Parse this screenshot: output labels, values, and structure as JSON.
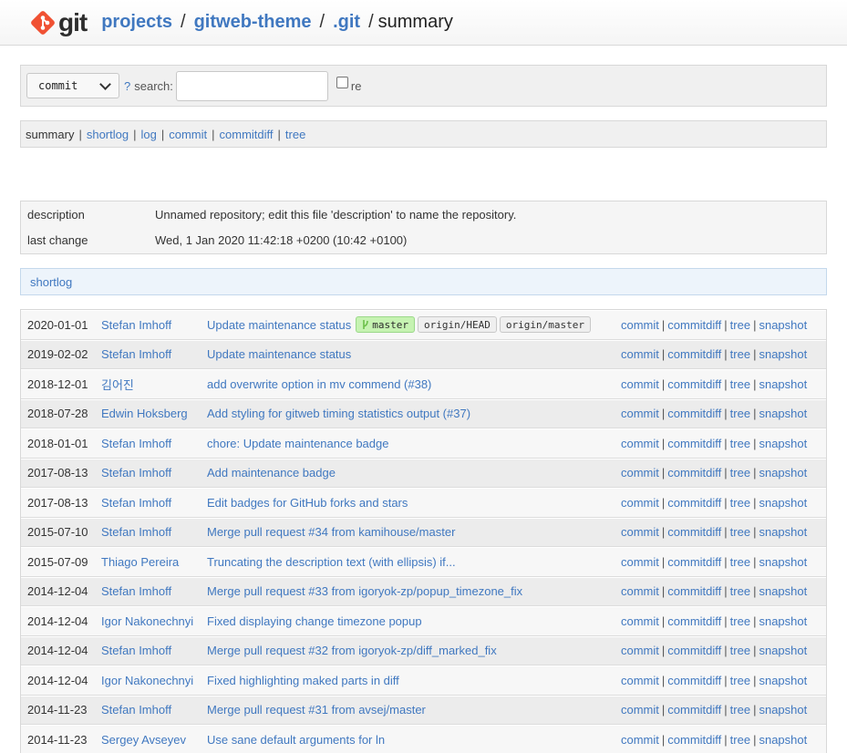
{
  "header": {
    "logo_text": "git",
    "crumbs": [
      "projects",
      "gitweb-theme",
      ".git"
    ],
    "current": "summary",
    "separator": "/"
  },
  "search": {
    "select_value": "commit",
    "help": "?",
    "label": "search:",
    "input_value": "",
    "regex_label": "re"
  },
  "nav": {
    "current": "summary",
    "links": [
      "shortlog",
      "log",
      "commit",
      "commitdiff",
      "tree"
    ],
    "separator": "|"
  },
  "info": {
    "description_key": "description",
    "description_value": "Unnamed repository; edit this file 'description' to name the repository.",
    "last_change_key": "last change",
    "last_change_value": "Wed, 1 Jan 2020 11:42:18 +0200 (10:42 +0100)"
  },
  "shortlog": {
    "title": "shortlog",
    "action_links": [
      "commit",
      "commitdiff",
      "tree",
      "snapshot"
    ],
    "refs_first_row": {
      "branch": "master",
      "remote1": "origin/HEAD",
      "remote2": "origin/master"
    },
    "rows": [
      {
        "date": "2020-01-01",
        "author": "Stefan Imhoff",
        "message": "Update maintenance status"
      },
      {
        "date": "2019-02-02",
        "author": "Stefan Imhoff",
        "message": "Update maintenance status"
      },
      {
        "date": "2018-12-01",
        "author": "김어진",
        "message": "add overwrite option in mv commend (#38)"
      },
      {
        "date": "2018-07-28",
        "author": "Edwin Hoksberg",
        "message": "Add styling for gitweb timing statistics output (#37)"
      },
      {
        "date": "2018-01-01",
        "author": "Stefan Imhoff",
        "message": "chore: Update maintenance badge"
      },
      {
        "date": "2017-08-13",
        "author": "Stefan Imhoff",
        "message": "Add maintenance badge"
      },
      {
        "date": "2017-08-13",
        "author": "Stefan Imhoff",
        "message": "Edit badges for GitHub forks and stars"
      },
      {
        "date": "2015-07-10",
        "author": "Stefan Imhoff",
        "message": "Merge pull request #34 from kamihouse/master"
      },
      {
        "date": "2015-07-09",
        "author": "Thiago Pereira",
        "message": "Truncating the description text (with ellipsis) if..."
      },
      {
        "date": "2014-12-04",
        "author": "Stefan Imhoff",
        "message": "Merge pull request #33 from igoryok-zp/popup_timezone_fix"
      },
      {
        "date": "2014-12-04",
        "author": "Igor Nakonechnyi",
        "message": "Fixed displaying change timezone popup"
      },
      {
        "date": "2014-12-04",
        "author": "Stefan Imhoff",
        "message": "Merge pull request #32 from igoryok-zp/diff_marked_fix"
      },
      {
        "date": "2014-12-04",
        "author": "Igor Nakonechnyi",
        "message": "Fixed highlighting maked parts in diff"
      },
      {
        "date": "2014-11-23",
        "author": "Stefan Imhoff",
        "message": "Merge pull request #31 from avsej/master"
      },
      {
        "date": "2014-11-23",
        "author": "Sergey Avseyev",
        "message": "Use sane default arguments for ln"
      }
    ]
  },
  "colors": {
    "link": "#4078c0",
    "logo_orange": "#f05133",
    "branch_badge": "#c6f3b2"
  }
}
